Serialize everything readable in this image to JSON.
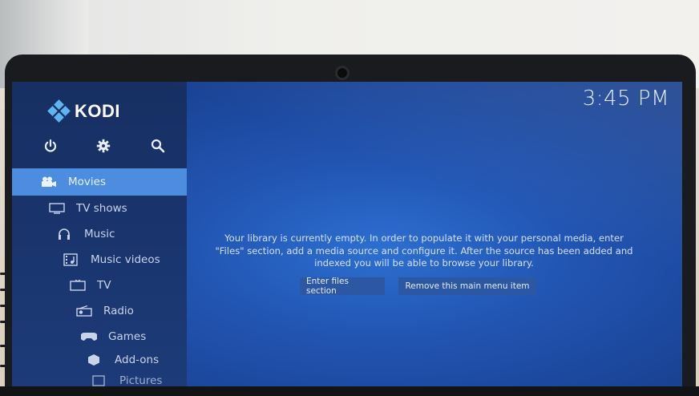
{
  "app": {
    "logo_text": "KODI",
    "clock": "3:45 PM"
  },
  "top_icons": [
    {
      "name": "power-icon"
    },
    {
      "name": "gear-icon"
    },
    {
      "name": "search-icon"
    }
  ],
  "menu": {
    "items": [
      {
        "label": "Movies",
        "icon": "movie-camera-icon",
        "active": true
      },
      {
        "label": "TV shows",
        "icon": "tv-icon"
      },
      {
        "label": "Music",
        "icon": "headphones-icon"
      },
      {
        "label": "Music videos",
        "icon": "music-video-icon"
      },
      {
        "label": "TV",
        "icon": "tv-icon"
      },
      {
        "label": "Radio",
        "icon": "radio-icon"
      },
      {
        "label": "Games",
        "icon": "gamepad-icon"
      },
      {
        "label": "Add-ons",
        "icon": "addon-box-icon"
      },
      {
        "label": "Pictures",
        "icon": "pictures-icon"
      }
    ]
  },
  "main": {
    "empty_message": "Your library is currently empty. In order to populate it with your personal media, enter \"Files\" section, add a media source and configure it. After the source has been added and indexed you will be able to browse your library.",
    "buttons": {
      "enter_files": "Enter files section",
      "remove_item": "Remove this main menu item"
    }
  },
  "colors": {
    "background": "#2256b4",
    "sidebar": "#1a3670",
    "active_item": "#4c8de0",
    "logo_accent": "#5fb4f0"
  }
}
